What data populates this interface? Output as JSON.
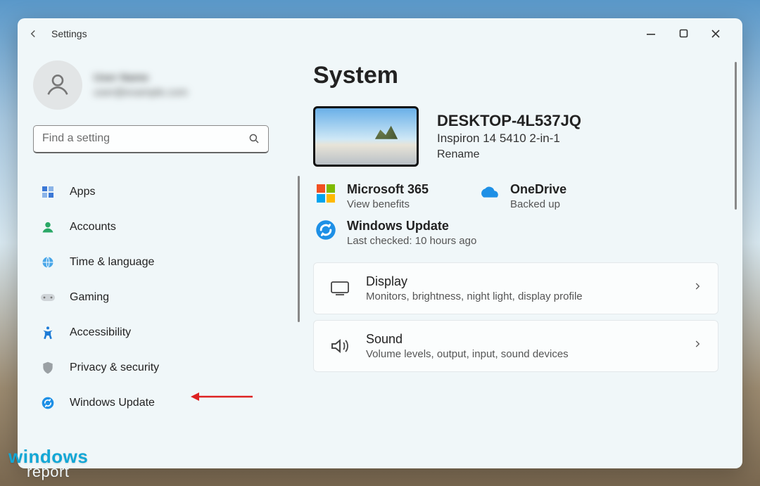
{
  "window": {
    "title": "Settings"
  },
  "user": {
    "name_line1": "User Name",
    "name_line2": "user@example.com"
  },
  "search": {
    "placeholder": "Find a setting"
  },
  "sidebar": {
    "items": [
      {
        "label": "Apps"
      },
      {
        "label": "Accounts"
      },
      {
        "label": "Time & language"
      },
      {
        "label": "Gaming"
      },
      {
        "label": "Accessibility"
      },
      {
        "label": "Privacy & security"
      },
      {
        "label": "Windows Update"
      }
    ]
  },
  "main": {
    "title": "System",
    "device": {
      "name": "DESKTOP-4L537JQ",
      "model": "Inspiron 14 5410 2-in-1",
      "rename": "Rename"
    },
    "services": {
      "m365": {
        "title": "Microsoft 365",
        "sub": "View benefits"
      },
      "onedrive": {
        "title": "OneDrive",
        "sub": "Backed up"
      },
      "update": {
        "title": "Windows Update",
        "sub": "Last checked: 10 hours ago"
      }
    },
    "cards": {
      "display": {
        "title": "Display",
        "sub": "Monitors, brightness, night light, display profile"
      },
      "sound": {
        "title": "Sound",
        "sub": "Volume levels, output, input, sound devices"
      }
    }
  },
  "watermark": {
    "l1": "windows",
    "l2": "report"
  }
}
